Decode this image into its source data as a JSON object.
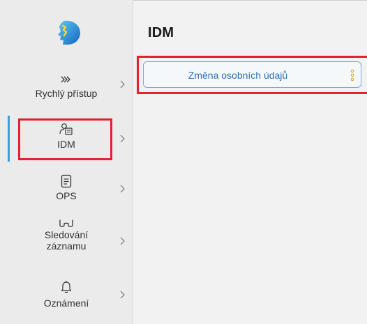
{
  "colors": {
    "accent_blue": "#3aa0d8",
    "highlight_red": "#e8202e",
    "sidebar_bg": "#ebebeb",
    "card_text": "#2f6fb0"
  },
  "sidebar": {
    "logo_icon": "head-logo-icon",
    "items": [
      {
        "label": "Rychlý přístup",
        "icon": "double-chevron-icon"
      },
      {
        "label": "IDM",
        "icon": "person-card-icon",
        "active": true
      },
      {
        "label": "OPS",
        "icon": "document-icon"
      },
      {
        "label": "Sledování záznamu",
        "icon": "glasses-icon"
      },
      {
        "label": "Oznámení",
        "icon": "bell-icon"
      }
    ]
  },
  "main": {
    "title": "IDM",
    "cards": [
      {
        "label": "Změna osobních údajů",
        "menu_icon": "kebab-menu-icon"
      }
    ]
  }
}
